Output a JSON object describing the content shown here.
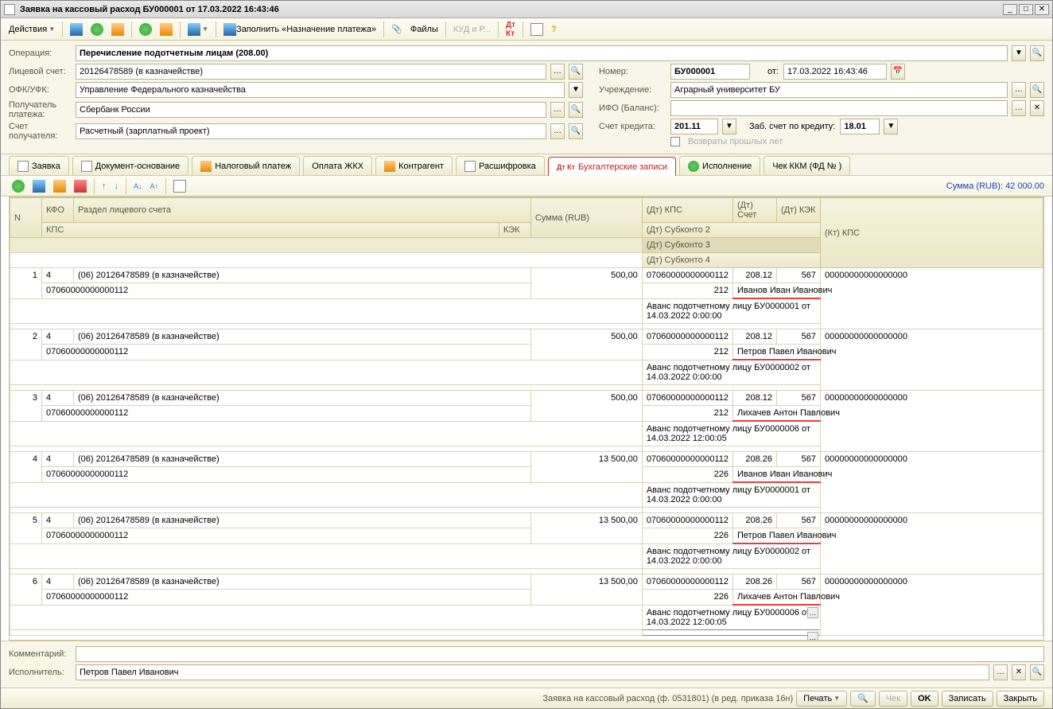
{
  "title": "Заявка на кассовый расход БУ000001 от 17.03.2022 16:43:46",
  "toolbar": {
    "actions": "Действия",
    "fill": "Заполнить «Назначение платежа»",
    "files": "Файлы",
    "kud": "КУД и Р..."
  },
  "form": {
    "operation_label": "Операция:",
    "operation_value": "Перечисление подотчетным лицам (208.00)",
    "account_label": "Лицевой счет:",
    "account_value": "20126478589 (в казначействе)",
    "ofk_label": "ОФК/УФК:",
    "ofk_value": "Управление Федерального казначейства",
    "recipient_label1": "Получатель",
    "recipient_label2": "платежа:",
    "recipient_value": "Сбербанк России",
    "recacct_label1": "Счет",
    "recacct_label2": "получателя:",
    "recacct_value": "Расчетный (зарплатный проект)",
    "number_label": "Номер:",
    "number_value": "БУ000001",
    "from_label": "от:",
    "date_value": "17.03.2022 16:43:46",
    "org_label": "Учреждение:",
    "org_value": "Аграрный университет БУ",
    "ifo_label": "ИФО (Баланс):",
    "credacct_label": "Счет кредита:",
    "credacct_value": "201.11",
    "zab_label": "Заб. счет по кредиту:",
    "zab_value": "18.01",
    "returns_label": "Возвраты прошлых лет"
  },
  "tabs": {
    "t1": "Заявка",
    "t2": "Документ-основание",
    "t3": "Налоговый платеж",
    "t4": "Оплата ЖКХ",
    "t5": "Контрагент",
    "t6": "Расшифровка",
    "t7": "Бухгалтерские записи",
    "t8": "Исполнение",
    "t9": "Чек ККМ (ФД № )"
  },
  "sum_total": "Сумма (RUB): 42 000.00",
  "headers": {
    "n": "N",
    "kfo": "КФО",
    "section": "Раздел лицевого счета",
    "kps": "КПС",
    "kek": "КЭК",
    "sum": "Сумма (RUB)",
    "dtkps": "(Дт) КПС",
    "dtacct": "(Дт) Счет",
    "dtkek": "(Дт) КЭК",
    "ktkps": "(Кт) КПС",
    "sub2": "(Дт) Субконто 2",
    "sub3": "(Дт) Субконто 3",
    "sub4": "(Дт) Субконто 4"
  },
  "rows": [
    {
      "n": "1",
      "kfo": "4",
      "section": "(06) 20126478589 (в казначействе)",
      "kps": "07060000000000112",
      "kek": "212",
      "sum": "500,00",
      "dtkps": "07060000000000112",
      "dtacct": "208.12",
      "dtkek": "567",
      "ktkps": "00000000000000000",
      "person": "Иванов Иван Иванович",
      "adv": "Аванс подотчетному лицу БУ0000001 от 14.03.2022 0:00:00"
    },
    {
      "n": "2",
      "kfo": "4",
      "section": "(06) 20126478589 (в казначействе)",
      "kps": "07060000000000112",
      "kek": "212",
      "sum": "500,00",
      "dtkps": "07060000000000112",
      "dtacct": "208.12",
      "dtkek": "567",
      "ktkps": "00000000000000000",
      "person": "Петров Павел Иванович",
      "adv": "Аванс подотчетному лицу БУ0000002 от 14.03.2022 0:00:00"
    },
    {
      "n": "3",
      "kfo": "4",
      "section": "(06) 20126478589 (в казначействе)",
      "kps": "07060000000000112",
      "kek": "212",
      "sum": "500,00",
      "dtkps": "07060000000000112",
      "dtacct": "208.12",
      "dtkek": "567",
      "ktkps": "00000000000000000",
      "person": "Лихачев Антон Павлович",
      "adv": "Аванс подотчетному лицу БУ0000006 от 14.03.2022 12:00:05"
    },
    {
      "n": "4",
      "kfo": "4",
      "section": "(06) 20126478589 (в казначействе)",
      "kps": "07060000000000112",
      "kek": "226",
      "sum": "13 500,00",
      "dtkps": "07060000000000112",
      "dtacct": "208.26",
      "dtkek": "567",
      "ktkps": "00000000000000000",
      "person": "Иванов Иван Иванович",
      "adv": "Аванс подотчетному лицу БУ0000001 от 14.03.2022 0:00:00"
    },
    {
      "n": "5",
      "kfo": "4",
      "section": "(06) 20126478589 (в казначействе)",
      "kps": "07060000000000112",
      "kek": "226",
      "sum": "13 500,00",
      "dtkps": "07060000000000112",
      "dtacct": "208.26",
      "dtkek": "567",
      "ktkps": "00000000000000000",
      "person": "Петров Павел Иванович",
      "adv": "Аванс подотчетному лицу БУ0000002 от 14.03.2022 0:00:00"
    },
    {
      "n": "6",
      "kfo": "4",
      "section": "(06) 20126478589 (в казначействе)",
      "kps": "07060000000000112",
      "kek": "226",
      "sum": "13 500,00",
      "dtkps": "07060000000000112",
      "dtacct": "208.26",
      "dtkek": "567",
      "ktkps": "00000000000000000",
      "person": "Лихачев Антон Павлович",
      "adv": "Аванс подотчетному лицу БУ0000006 от 14.03.2022 12:00:05"
    }
  ],
  "bottom": {
    "comment_label": "Комментарий:",
    "executor_label": "Исполнитель:",
    "executor_value": "Петров Павел Иванович"
  },
  "status": {
    "text": "Заявка на кассовый расход (ф. 0531801) (в ред. приказа 16н)",
    "print": "Печать",
    "check": "Чек",
    "ok": "OK",
    "save": "Записать",
    "close": "Закрыть"
  }
}
